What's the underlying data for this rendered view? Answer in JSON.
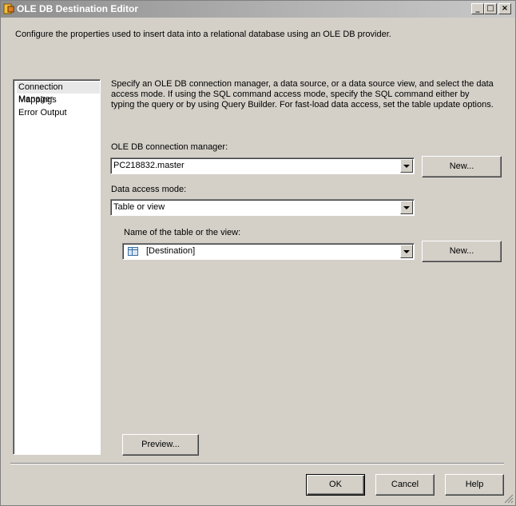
{
  "window": {
    "title": "OLE DB Destination Editor",
    "controls": {
      "minimize": "_",
      "maximize": "□",
      "close": "×"
    }
  },
  "header": {
    "description": "Configure the properties used to insert data into a relational database using an OLE DB provider."
  },
  "nav": {
    "items": [
      {
        "label": "Connection Manager",
        "selected": true
      },
      {
        "label": "Mappings",
        "selected": false
      },
      {
        "label": "Error Output",
        "selected": false
      }
    ]
  },
  "main": {
    "description": "Specify an OLE DB connection manager, a data source, or a data source view, and select the data access mode. If using the SQL command access mode, specify the SQL command either by typing the query or by using Query Builder. For fast-load data access, set the table update options.",
    "connection_manager": {
      "label": "OLE DB connection manager:",
      "value": "PC218832.master",
      "new_button": "New..."
    },
    "access_mode": {
      "label": "Data access mode:",
      "value": "Table or view"
    },
    "table_name": {
      "label": "Name of the table or the view:",
      "value": "[Destination]",
      "new_button": "New..."
    },
    "preview_button": "Preview..."
  },
  "footer": {
    "ok": "OK",
    "cancel": "Cancel",
    "help": "Help"
  }
}
